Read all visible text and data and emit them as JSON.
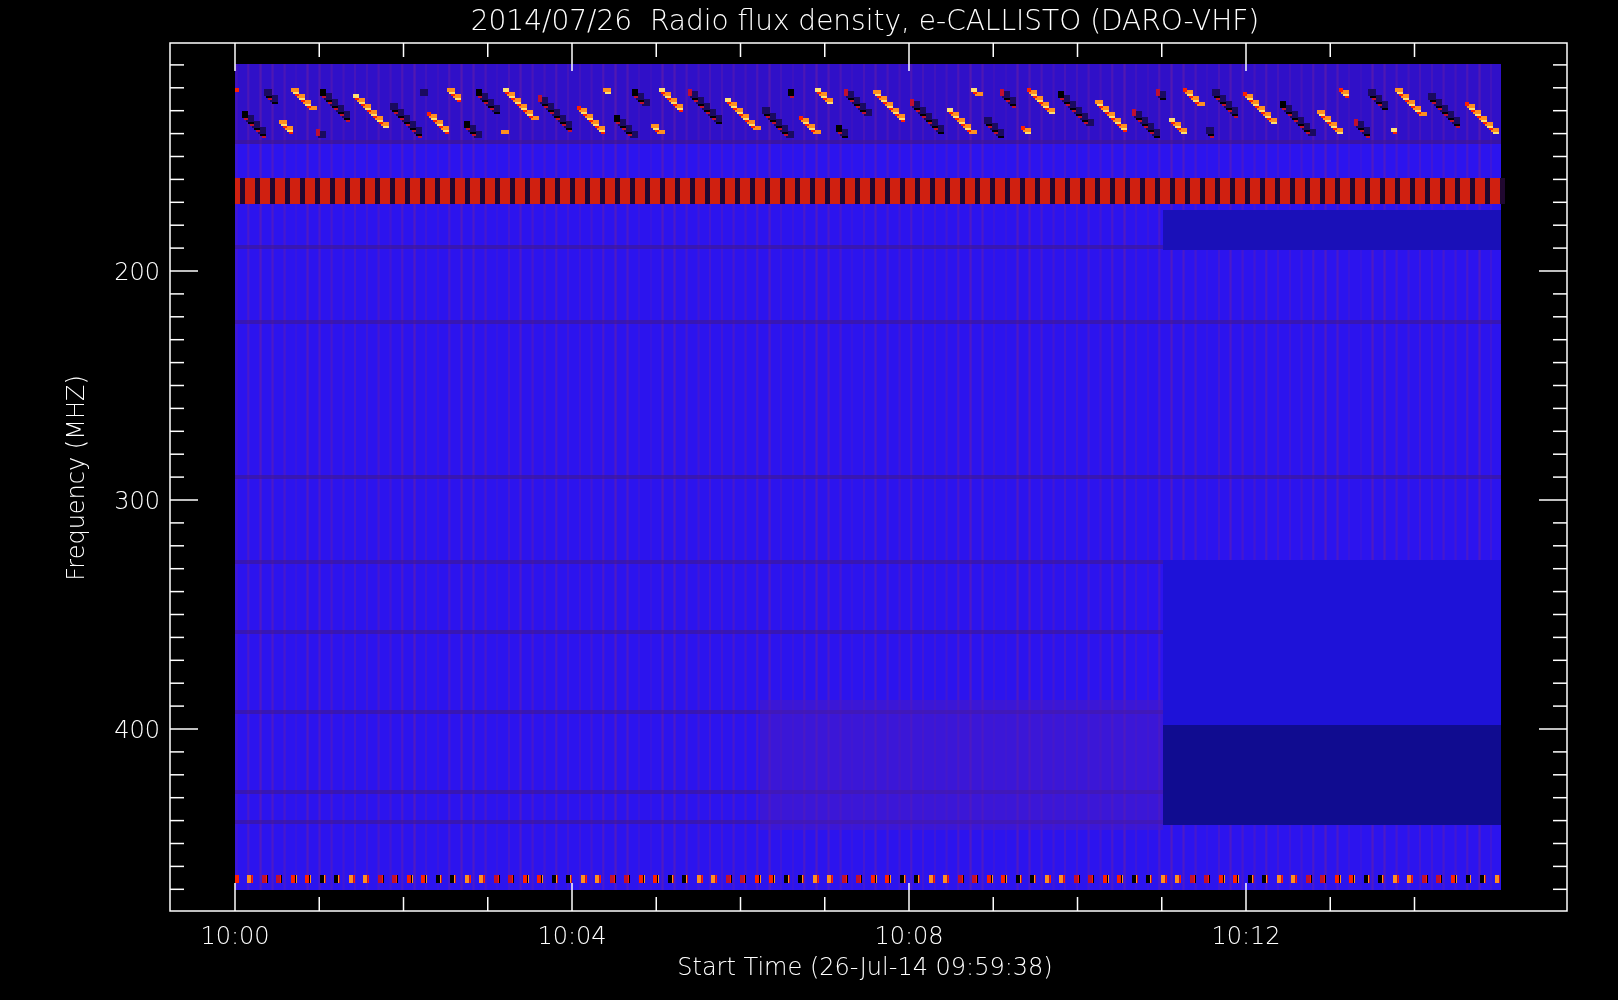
{
  "title": "2014/07/26  Radio flux density, e-CALLISTO (DARO-VHF)",
  "y_axis": {
    "label": "Frequency (MHZ)",
    "ticks": [
      "200",
      "300",
      "400"
    ]
  },
  "x_axis": {
    "label": "Start Time (26-Jul-14 09:59:38)",
    "ticks": [
      "10:00",
      "10:04",
      "10:08",
      "10:12"
    ]
  }
}
